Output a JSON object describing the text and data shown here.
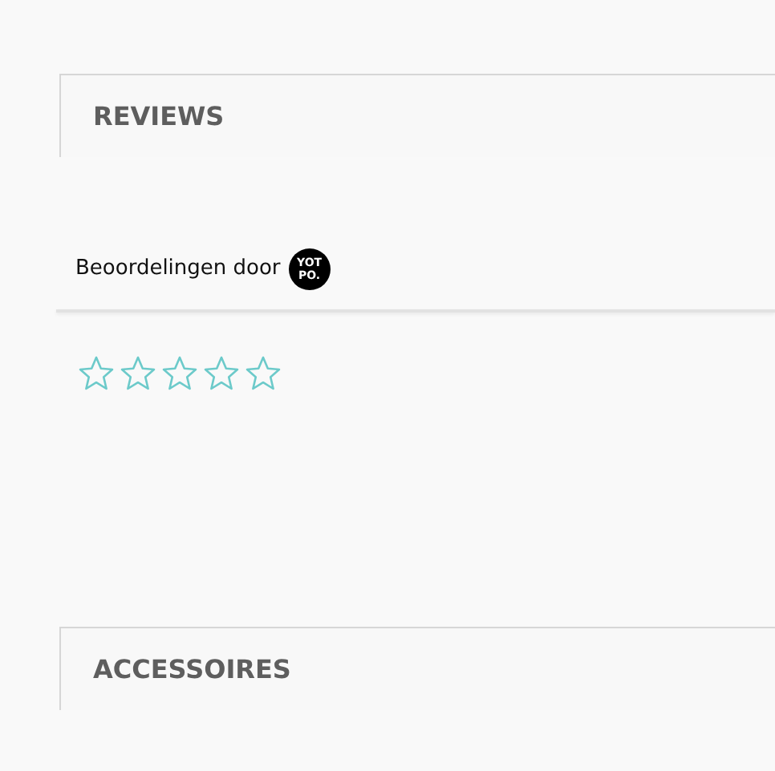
{
  "sections": [
    {
      "title": "REVIEWS"
    },
    {
      "title": "ACCESSOIRES"
    }
  ],
  "reviews": {
    "powered_by": "Beoordelingen door",
    "logo": [
      "YOT",
      "PO."
    ],
    "stars": 0
  }
}
